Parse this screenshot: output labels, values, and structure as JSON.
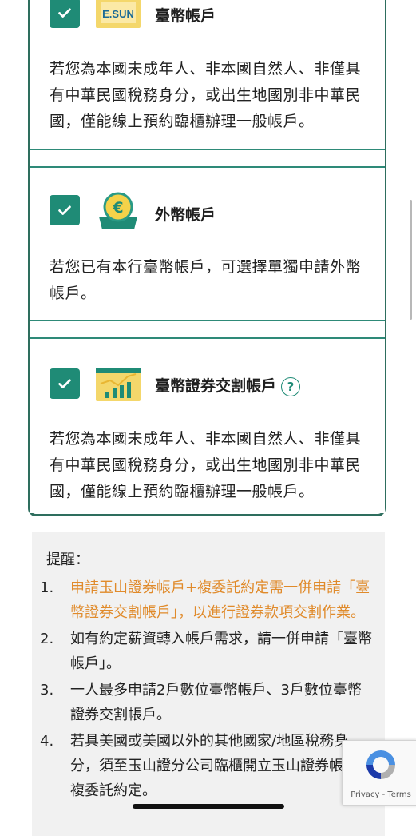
{
  "accounts": [
    {
      "title": "臺幣帳戶",
      "checked": true,
      "icon": "esun-bank-icon",
      "icon_label": "E.SUN",
      "desc": "若您為本國未成年人、非本國自然人、非僅具有中華民國稅務身分，或出生地國別非中華民國，僅能線上預約臨櫃辦理一般帳戶。"
    },
    {
      "title": "外幣帳戶",
      "checked": true,
      "icon": "euro-coin-icon",
      "desc": "若您已有本行臺幣帳戶，可選擇單獨申請外幣帳戶。"
    },
    {
      "title": "臺幣證券交割帳戶",
      "checked": true,
      "icon": "stock-chart-icon",
      "help_label": "?",
      "desc": "若您為本國未成年人、非本國自然人、非僅具有中華民國稅務身分，或出生地國別非中華民國，僅能線上預約臨櫃辦理一般帳戶。"
    }
  ],
  "notice": {
    "title": "提醒：",
    "items": [
      {
        "num": "1.",
        "text": "申請玉山證券帳戶+複委託約定需一併申請「臺幣證券交割帳戶」，以進行證券款項交割作業。",
        "highlight": true
      },
      {
        "num": "2.",
        "text": "如有約定薪資轉入帳戶需求，請一併申請「臺幣帳戶」。",
        "highlight": false
      },
      {
        "num": "3.",
        "text": "一人最多申請2戶數位臺幣帳戶、3戶數位臺幣證券交割帳戶。",
        "highlight": false
      },
      {
        "num": "4.",
        "text": "若具美國或美國以外的其他國家/地區稅務身分，須至玉山證分公司臨櫃開立玉山證券帳戶＋複委託約定。",
        "highlight": false
      }
    ]
  },
  "recaptcha": {
    "links": "Privacy - Terms"
  },
  "colors": {
    "accent": "#1f8b76",
    "border": "#2e6e5e",
    "highlight": "#e08a2a",
    "notice_bg": "#f1f1f1"
  }
}
